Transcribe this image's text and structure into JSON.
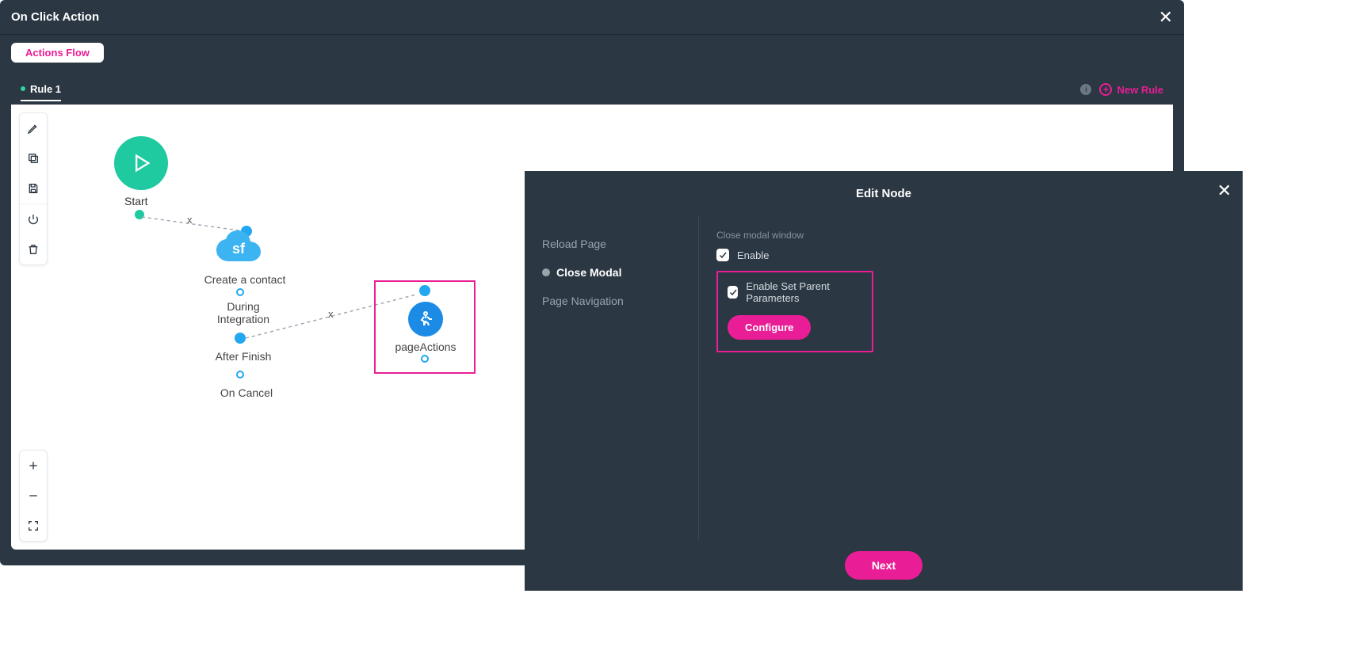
{
  "header": {
    "title": "On Click Action"
  },
  "tabs": {
    "actions_flow": "Actions Flow"
  },
  "rulebar": {
    "tab": "Rule 1",
    "new_rule": "New Rule",
    "info": "i"
  },
  "flow": {
    "start": "Start",
    "create_contact": "Create a contact",
    "during": "During\nIntegration",
    "after": "After Finish",
    "cancel": "On Cancel",
    "page_actions": "pageActions",
    "x": "x",
    "sf": "sf"
  },
  "edit": {
    "title": "Edit Node",
    "sidebar": {
      "reload": "Reload Page",
      "close_modal": "Close Modal",
      "page_nav": "Page Navigation"
    },
    "section_title": "Close modal window",
    "enable": "Enable",
    "enable_parent": "Enable Set Parent Parameters",
    "configure": "Configure",
    "next": "Next"
  }
}
